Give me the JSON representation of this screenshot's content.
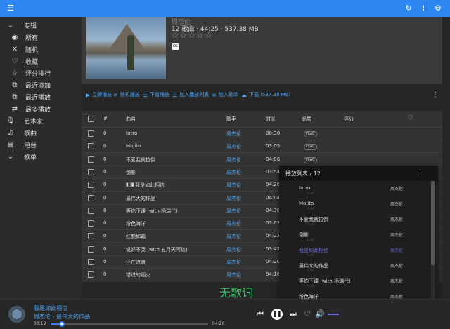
{
  "topbar": {
    "icons": [
      "refresh-icon",
      "activity-icon",
      "settings-icon"
    ],
    "color": "#2e87f0"
  },
  "sidebar": {
    "sections": [
      {
        "label": "专辑",
        "icon": "album-icon",
        "items": [
          {
            "label": "所有",
            "icon": "album-icon"
          },
          {
            "label": "随机",
            "icon": "shuffle-icon"
          },
          {
            "label": "收藏",
            "icon": "heart-icon"
          },
          {
            "label": "评分排行",
            "icon": "star-icon"
          },
          {
            "label": "最近添加",
            "icon": "library-add-icon"
          },
          {
            "label": "最近播放",
            "icon": "history-icon"
          },
          {
            "label": "最多播放",
            "icon": "repeat-icon"
          }
        ]
      },
      {
        "label": "艺术家",
        "icon": "mic-icon",
        "items": []
      },
      {
        "label": "歌曲",
        "icon": "music-note-icon",
        "items": []
      },
      {
        "label": "电台",
        "icon": "radio-icon",
        "items": []
      },
      {
        "label": "歌单",
        "icon": "playlist-icon",
        "items": []
      }
    ]
  },
  "album": {
    "artist": "周杰伦",
    "meta": "12 歌曲 · 44:25 · 537.38 MB",
    "rating": 0,
    "max_rating": 5,
    "badge": "OS"
  },
  "actions": [
    {
      "label": "立即播放",
      "icon": "play-icon"
    },
    {
      "label": "随机播放",
      "icon": "shuffle-icon"
    },
    {
      "label": "下首播放",
      "icon": "next-queue-icon"
    },
    {
      "label": "加入播放列表",
      "icon": "add-queue-icon"
    },
    {
      "label": "加入歌单",
      "icon": "playlist-add-icon"
    },
    {
      "label": "下载 (537.38 MB)",
      "icon": "download-icon"
    }
  ],
  "table": {
    "columns": {
      "num": "#",
      "title": "曲名",
      "artist": "歌手",
      "duration": "时长",
      "quality": "品质",
      "rating": "评分"
    },
    "rows": [
      {
        "num": "0",
        "title": "Intro",
        "artist": "周杰伦",
        "duration": "00:30",
        "quality": "FLAC"
      },
      {
        "num": "0",
        "title": "Mojito",
        "artist": "周杰伦",
        "duration": "03:05",
        "quality": "FLAC"
      },
      {
        "num": "0",
        "title": "不爱我就拉倒",
        "artist": "周杰伦",
        "duration": "04:06",
        "quality": "FLAC"
      },
      {
        "num": "0",
        "title": "倒影",
        "artist": "周杰伦",
        "duration": "03:54",
        "quality": "FLAC"
      },
      {
        "num": "0",
        "title": "我是如此相信",
        "artist": "周杰伦",
        "duration": "04:26",
        "quality": "FLAC",
        "playing": true
      },
      {
        "num": "0",
        "title": "最伟大的作品",
        "artist": "周杰伦",
        "duration": "04:04",
        "quality": "FLAC"
      },
      {
        "num": "0",
        "title": "等你下课 (with 杨瑞代)",
        "artist": "周杰伦",
        "duration": "04:30",
        "quality": "FLAC"
      },
      {
        "num": "0",
        "title": "粉色海洋",
        "artist": "周杰伦",
        "duration": "03:07",
        "quality": "FLAC"
      },
      {
        "num": "0",
        "title": "红颜如霜",
        "artist": "周杰伦",
        "duration": "04:22",
        "quality": "FLAC"
      },
      {
        "num": "0",
        "title": "说好不哭 (with 五月天阿信)",
        "artist": "周杰伦",
        "duration": "03:42",
        "quality": "FLAC"
      },
      {
        "num": "0",
        "title": "还在流浪",
        "artist": "周杰伦",
        "duration": "04:20",
        "quality": "FLAC"
      },
      {
        "num": "0",
        "title": "错过的烟火",
        "artist": "周杰伦",
        "duration": "04:18",
        "quality": "FLAC"
      }
    ]
  },
  "no_lyrics": "无歌词",
  "playlist": {
    "title": "播放列表 / 12",
    "items": [
      {
        "title": "Intro",
        "artist": "周杰伦",
        "quality": "FLAC"
      },
      {
        "title": "Mojito",
        "artist": "周杰伦",
        "quality": "FLAC"
      },
      {
        "title": "不爱我就拉倒",
        "artist": "周杰伦",
        "quality": "FLAC"
      },
      {
        "title": "倒影",
        "artist": "周杰伦",
        "quality": "FLAC"
      },
      {
        "title": "我是如此相信",
        "artist": "周杰伦",
        "quality": "FLAC",
        "current": true
      },
      {
        "title": "最伟大的作品",
        "artist": "周杰伦",
        "quality": "FLAC"
      },
      {
        "title": "等你下课 (with 杨瑞代)",
        "artist": "周杰伦",
        "quality": "FLAC"
      },
      {
        "title": "粉色海洋",
        "artist": "周杰伦",
        "quality": "FLAC"
      }
    ]
  },
  "player": {
    "title": "我是如此相信",
    "subtitle": "周杰伦 - 最伟大的作品",
    "current_time": "00:19",
    "total_time": "04:26",
    "progress": 0.071,
    "accent": "#2e87f0",
    "current_color": "#6b6bd6"
  }
}
